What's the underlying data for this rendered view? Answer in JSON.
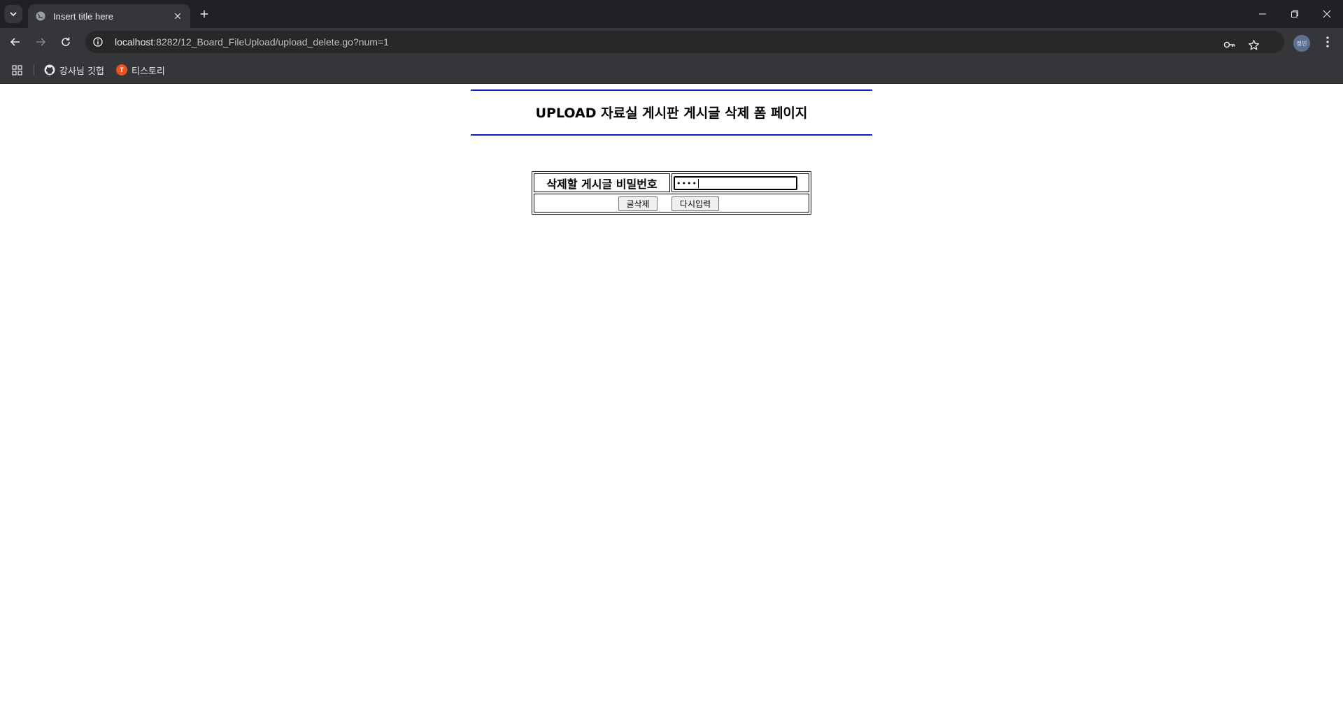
{
  "browser": {
    "tab_title": "Insert title here",
    "url_host": "localhost",
    "url_path": ":8282/12_Board_FileUpload/upload_delete.go?num=1",
    "profile_initials": "정민",
    "bookmarks": [
      {
        "label": "강사님 깃헙",
        "icon": "github-icon"
      },
      {
        "label": "티스토리",
        "icon": "tistory-icon"
      }
    ]
  },
  "page": {
    "title": "UPLOAD 자료실 게시판 게시글 삭제 폼 페이지",
    "password_label": "삭제할 게시글 비밀번호",
    "password_value": "••••",
    "delete_button": "글삭제",
    "reset_button": "다시입력",
    "accent_color": "#1a1ab8"
  }
}
